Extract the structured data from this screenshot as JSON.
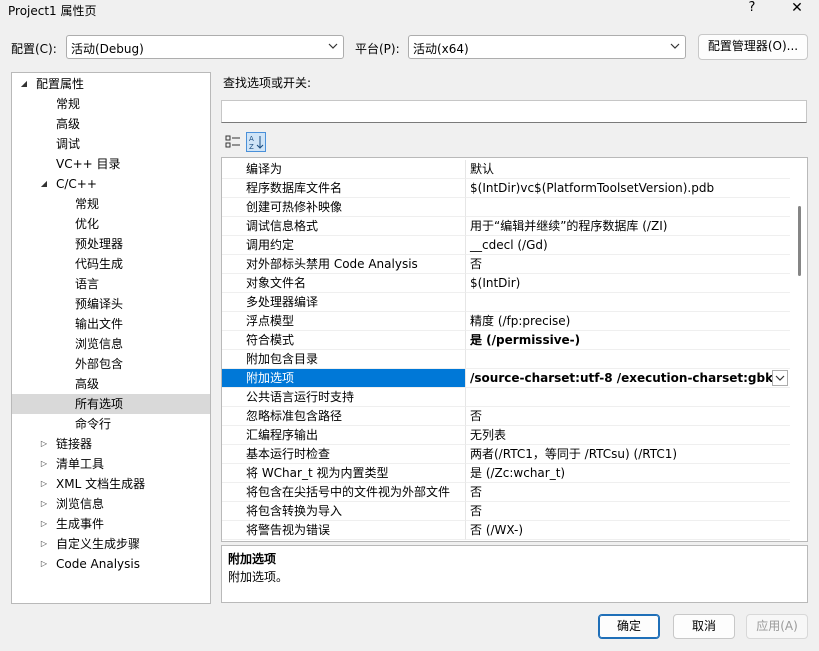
{
  "window": {
    "title": "Project1 属性页",
    "help": "?",
    "close": "✕"
  },
  "config": {
    "config_label": "配置(C):",
    "config_value": "活动(Debug)",
    "platform_label": "平台(P):",
    "platform_value": "活动(x64)",
    "manager_button": "配置管理器(O)..."
  },
  "tree": [
    {
      "label": "配置属性",
      "level": 0,
      "twisty": "◢"
    },
    {
      "label": "常规",
      "level": 1,
      "twisty": ""
    },
    {
      "label": "高级",
      "level": 1,
      "twisty": ""
    },
    {
      "label": "调试",
      "level": 1,
      "twisty": ""
    },
    {
      "label": "VC++ 目录",
      "level": 1,
      "twisty": ""
    },
    {
      "label": "C/C++",
      "level": 1,
      "twisty": "◢"
    },
    {
      "label": "常规",
      "level": 2,
      "twisty": ""
    },
    {
      "label": "优化",
      "level": 2,
      "twisty": ""
    },
    {
      "label": "预处理器",
      "level": 2,
      "twisty": ""
    },
    {
      "label": "代码生成",
      "level": 2,
      "twisty": ""
    },
    {
      "label": "语言",
      "level": 2,
      "twisty": ""
    },
    {
      "label": "预编译头",
      "level": 2,
      "twisty": ""
    },
    {
      "label": "输出文件",
      "level": 2,
      "twisty": ""
    },
    {
      "label": "浏览信息",
      "level": 2,
      "twisty": ""
    },
    {
      "label": "外部包含",
      "level": 2,
      "twisty": ""
    },
    {
      "label": "高级",
      "level": 2,
      "twisty": ""
    },
    {
      "label": "所有选项",
      "level": 2,
      "twisty": "",
      "selected": true
    },
    {
      "label": "命令行",
      "level": 2,
      "twisty": ""
    },
    {
      "label": "链接器",
      "level": 1,
      "twisty": "▷"
    },
    {
      "label": "清单工具",
      "level": 1,
      "twisty": "▷"
    },
    {
      "label": "XML 文档生成器",
      "level": 1,
      "twisty": "▷"
    },
    {
      "label": "浏览信息",
      "level": 1,
      "twisty": "▷"
    },
    {
      "label": "生成事件",
      "level": 1,
      "twisty": "▷"
    },
    {
      "label": "自定义生成步骤",
      "level": 1,
      "twisty": "▷"
    },
    {
      "label": "Code Analysis",
      "level": 1,
      "twisty": "▷"
    }
  ],
  "search": {
    "label": "查找选项或开关:",
    "value": ""
  },
  "properties": [
    {
      "name": "编译为",
      "value": "默认"
    },
    {
      "name": "程序数据库文件名",
      "value": "$(IntDir)vc$(PlatformToolsetVersion).pdb"
    },
    {
      "name": "创建可热修补映像",
      "value": ""
    },
    {
      "name": "调试信息格式",
      "value": "用于“编辑并继续”的程序数据库 (/ZI)"
    },
    {
      "name": "调用约定",
      "value": "__cdecl (/Gd)"
    },
    {
      "name": "对外部标头禁用 Code Analysis",
      "value": "否"
    },
    {
      "name": "对象文件名",
      "value": "$(IntDir)"
    },
    {
      "name": "多处理器编译",
      "value": ""
    },
    {
      "name": "浮点模型",
      "value": "精度 (/fp:precise)"
    },
    {
      "name": "符合模式",
      "value": "是 (/permissive-)",
      "bold": true
    },
    {
      "name": "附加包含目录",
      "value": ""
    },
    {
      "name": "附加选项",
      "value": "/source-charset:utf-8 /execution-charset:gbk",
      "bold": true,
      "selected": true
    },
    {
      "name": "公共语言运行时支持",
      "value": ""
    },
    {
      "name": "忽略标准包含路径",
      "value": "否"
    },
    {
      "name": "汇编程序输出",
      "value": "无列表"
    },
    {
      "name": "基本运行时检查",
      "value": "两者(/RTC1，等同于 /RTCsu) (/RTC1)"
    },
    {
      "name": "将 WChar_t 视为内置类型",
      "value": "是 (/Zc:wchar_t)"
    },
    {
      "name": "将包含在尖括号中的文件视为外部文件",
      "value": "否"
    },
    {
      "name": "将包含转换为导入",
      "value": "否"
    },
    {
      "name": "将警告视为错误",
      "value": "否 (/WX-)"
    }
  ],
  "description": {
    "title": "附加选项",
    "text": "附加选项。"
  },
  "buttons": {
    "ok": "确定",
    "cancel": "取消",
    "apply": "应用(A)"
  },
  "colors": {
    "selection": "#0078d7",
    "tree_selected": "#d9d9d9"
  }
}
